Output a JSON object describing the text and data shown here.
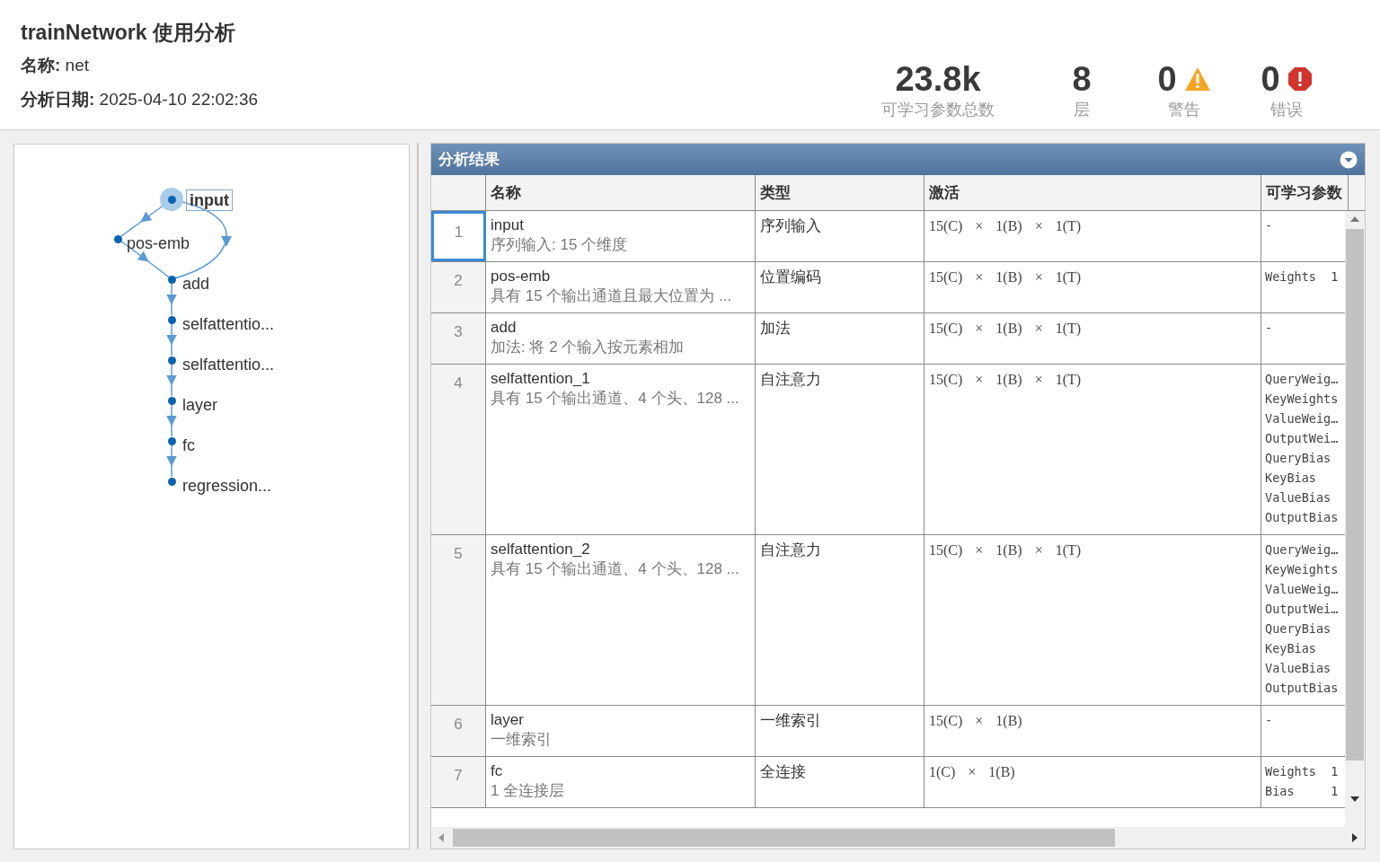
{
  "header": {
    "title": "trainNetwork 使用分析",
    "name_line": "**名称:** net",
    "date_line": "**分析日期:** 2025-04-10 22:02:36"
  },
  "stats": [
    {
      "value": "23.8k",
      "label": "可学习参数总数",
      "kind": "plain"
    },
    {
      "value": "8",
      "label": "层",
      "kind": "plain"
    },
    {
      "value": "0",
      "label": "警告",
      "kind": "warning"
    },
    {
      "value": "0",
      "label": "错误",
      "kind": "error"
    }
  ],
  "graph": {
    "nodes": [
      {
        "label": "input",
        "selected": true
      },
      {
        "label": "pos-emb",
        "selected": false
      },
      {
        "label": "add",
        "selected": false
      },
      {
        "label": "selfattentio...",
        "selected": false
      },
      {
        "label": "selfattentio...",
        "selected": false
      },
      {
        "label": "layer",
        "selected": false
      },
      {
        "label": "fc",
        "selected": false
      },
      {
        "label": "regression...",
        "selected": false
      }
    ]
  },
  "results": {
    "title": "分析结果",
    "columns": [
      "名称",
      "类型",
      "激活",
      "可学习参数"
    ],
    "rows": [
      {
        "number": "1",
        "name": "input",
        "description": "序列输入: 15 个维度",
        "type": "序列输入",
        "activation": "15(C) × 1(B) × 1(T)",
        "params": [
          "-"
        ],
        "selected": true
      },
      {
        "number": "2",
        "name": "pos-emb",
        "description": "具有 15 个输出通道且最大位置为 ...",
        "type": "位置编码",
        "activation": "15(C) × 1(B) × 1(T)",
        "params": [
          "Weights  1"
        ],
        "selected": false
      },
      {
        "number": "3",
        "name": "add",
        "description": "加法: 将 2 个输入按元素相加",
        "type": "加法",
        "activation": "15(C) × 1(B) × 1(T)",
        "params": [
          "-"
        ],
        "selected": false
      },
      {
        "number": "4",
        "name": "selfattention_1",
        "description": "具有 15 个输出通道、4 个头、128 ...",
        "type": "自注意力",
        "activation": "15(C) × 1(B) × 1(T)",
        "params": [
          "QueryWeig…",
          "KeyWeights",
          "ValueWeig…",
          "OutputWei…",
          "QueryBias",
          "KeyBias",
          "ValueBias",
          "OutputBias"
        ],
        "selected": false
      },
      {
        "number": "5",
        "name": "selfattention_2",
        "description": "具有 15 个输出通道、4 个头、128 ...",
        "type": "自注意力",
        "activation": "15(C) × 1(B) × 1(T)",
        "params": [
          "QueryWeig…",
          "KeyWeights",
          "ValueWeig…",
          "OutputWei…",
          "QueryBias",
          "KeyBias",
          "ValueBias",
          "OutputBias"
        ],
        "selected": false
      },
      {
        "number": "6",
        "name": "layer",
        "description": "一维索引",
        "type": "一维索引",
        "activation": "15(C) × 1(B)",
        "params": [
          "-"
        ],
        "selected": false
      },
      {
        "number": "7",
        "name": "fc",
        "description": "1 全连接层",
        "type": "全连接",
        "activation": "1(C) × 1(B)",
        "params": [
          "Weights  1",
          "Bias     1"
        ],
        "selected": false
      }
    ]
  }
}
